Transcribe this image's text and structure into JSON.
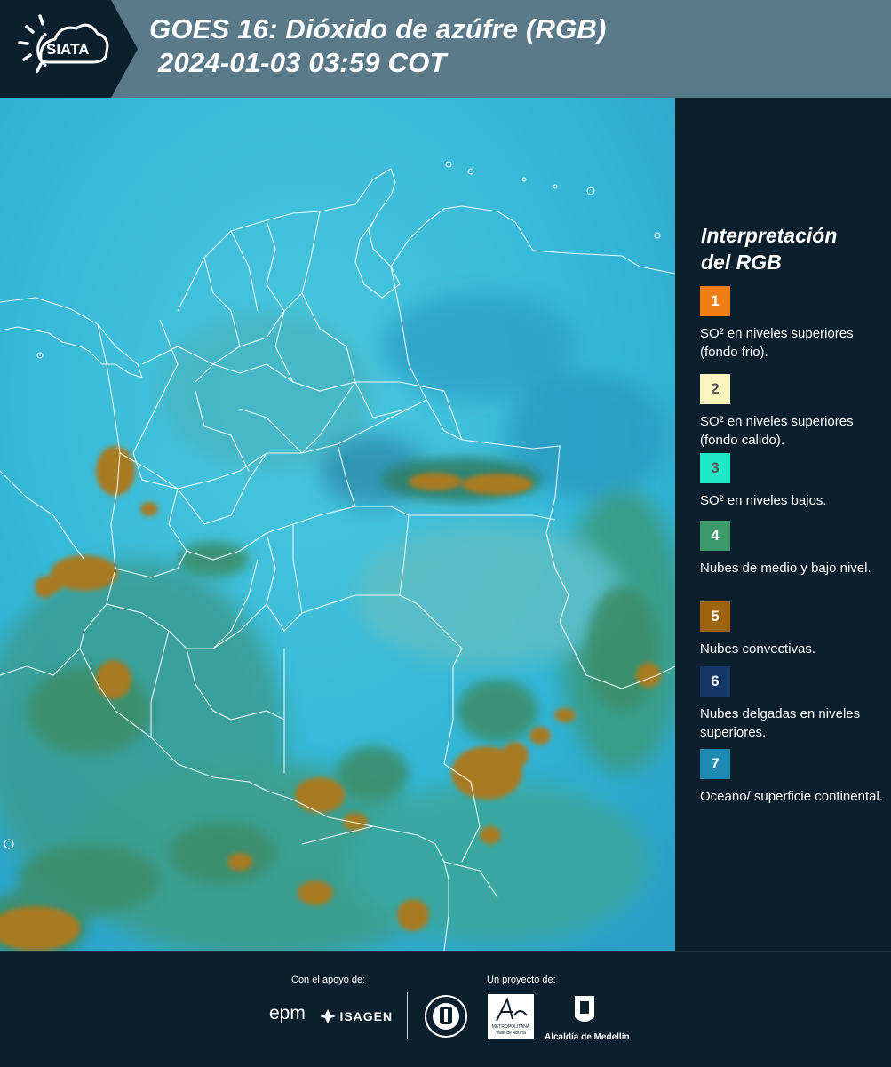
{
  "header": {
    "logo_text": "SIATA",
    "title_line1": "GOES 16: Dióxido de azúfre (RGB)",
    "title_line2": "2024-01-03 03:59 COT"
  },
  "legend": {
    "title_line1": "Interpretación",
    "title_line2": "del RGB",
    "items": [
      {
        "num": "1",
        "color": "#f07d16",
        "numColor": "#ffffff",
        "desc": "SO² en niveles superiores (fondo frio)."
      },
      {
        "num": "2",
        "color": "#fdf5c0",
        "numColor": "#555555",
        "desc": "SO² en niveles superiores (fondo calido)."
      },
      {
        "num": "3",
        "color": "#1fe8c7",
        "numColor": "#555555",
        "desc": "SO² en niveles bajos."
      },
      {
        "num": "4",
        "color": "#3d9a6b",
        "numColor": "#ffffff",
        "desc": "Nubes de medio y bajo nivel."
      },
      {
        "num": "5",
        "color": "#9c640f",
        "numColor": "#ffffff",
        "desc": "Nubes convectivas."
      },
      {
        "num": "6",
        "color": "#153767",
        "numColor": "#ffffff",
        "desc": "Nubes delgadas en niveles superiores."
      },
      {
        "num": "7",
        "color": "#1f8bb2",
        "numColor": "#ffffff",
        "desc": "Oceano/ superficie continental."
      }
    ]
  },
  "footer": {
    "support_label": "Con el apoyo de:",
    "project_label": "Un proyecto de:",
    "sponsor1": "epm",
    "sponsor2": "ISAGEN",
    "sponsor3_line1": "METROPOLITANA",
    "sponsor3_line2": "Valle de Aburrá",
    "sponsor4": "Alcaldía de Medellín"
  },
  "map": {
    "ocean_color": "#2fb4d3",
    "land_color": "#3fc0cc",
    "convective_color": "#a87a24",
    "lowcloud_color": "#3a8e6c"
  }
}
